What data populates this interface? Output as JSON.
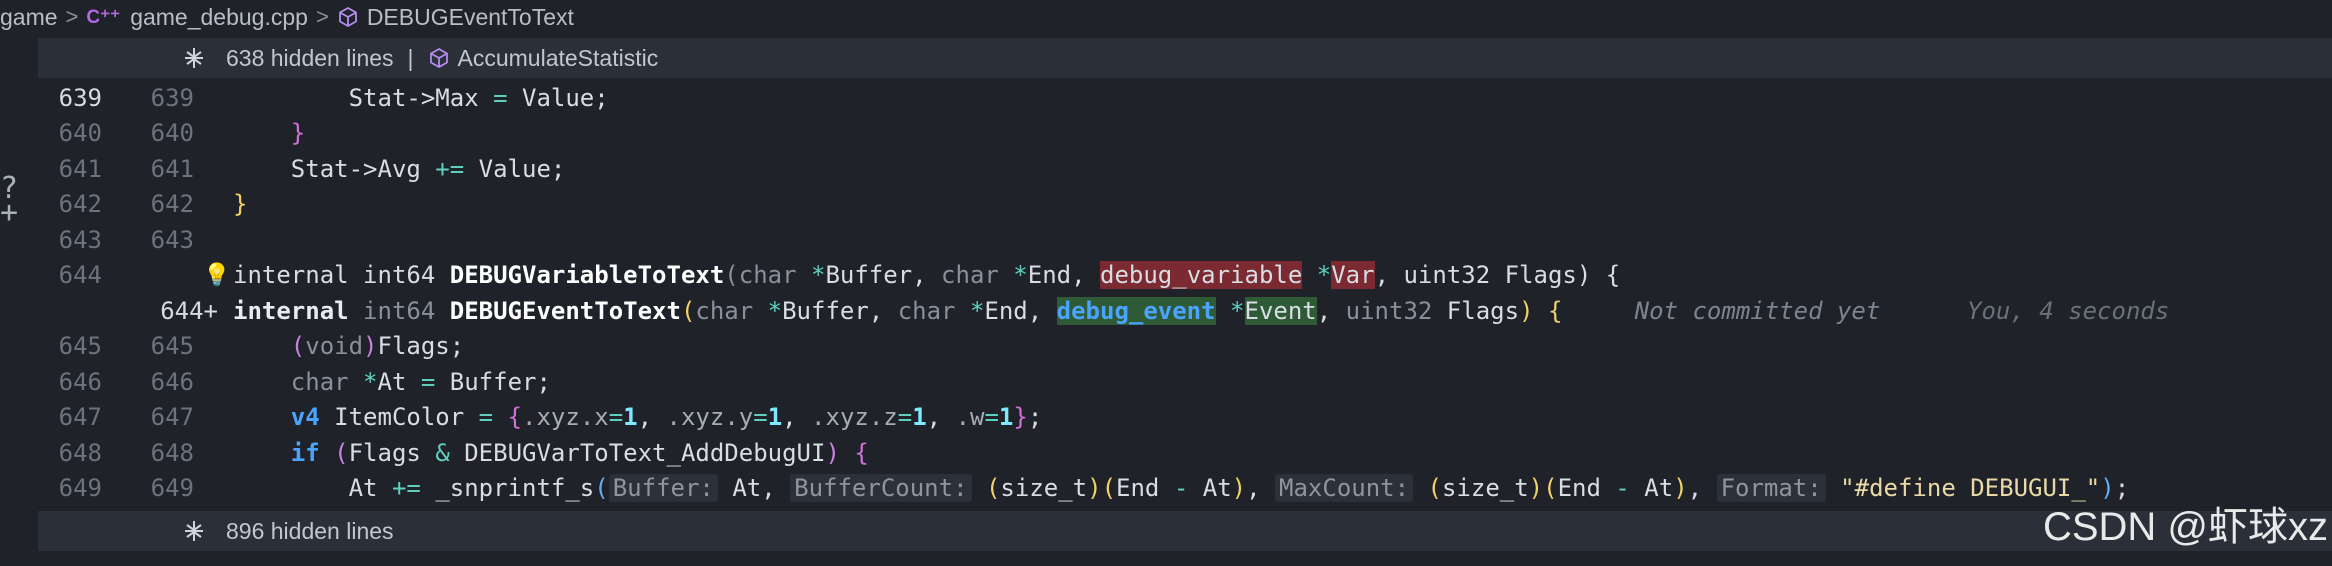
{
  "breadcrumb": {
    "root": "game",
    "file": "game_debug.cpp",
    "symbol": "DEBUGEventToText"
  },
  "hidden_top": {
    "label": "638 hidden lines",
    "pipe": "|",
    "symbol": "AccumulateStatistic"
  },
  "hidden_bottom": {
    "label": "896 hidden lines"
  },
  "lines": {
    "l639": {
      "old": "639",
      "new": "639"
    },
    "l640": {
      "old": "640",
      "new": "640"
    },
    "l641": {
      "old": "641",
      "new": "641"
    },
    "l642": {
      "old": "642",
      "new": "642"
    },
    "l643": {
      "old": "643",
      "new": "643"
    },
    "l644r": {
      "old": "644",
      "new": ""
    },
    "l644a": {
      "old": "",
      "new": "644+"
    },
    "l645": {
      "old": "645",
      "new": "645"
    },
    "l646": {
      "old": "646",
      "new": "646"
    },
    "l647": {
      "old": "647",
      "new": "647"
    },
    "l648": {
      "old": "648",
      "new": "648"
    },
    "l649": {
      "old": "649",
      "new": "649"
    }
  },
  "blame": {
    "status": "Not committed yet",
    "author_time": "You, 4 seconds"
  },
  "watermark": "CSDN @虾球xz",
  "colors": {
    "removed_bg": "#5c2a30",
    "added_bg": "#334734",
    "keyword_blue": "#4aa3ff"
  }
}
